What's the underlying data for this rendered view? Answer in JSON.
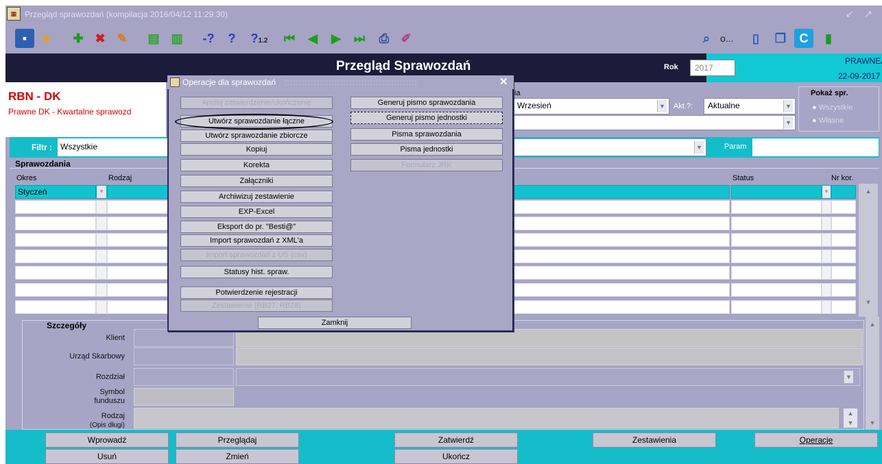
{
  "window": {
    "title": "Przegląd sprawozdań (kompilacja 2016/04/12 11:29:30)",
    "min_max": "↙ ↗"
  },
  "toolbar": {
    "icons": [
      "save-icon",
      "exit-icon",
      "add-icon",
      "delete-icon",
      "edit-icon",
      "expand-icon",
      "collapse-icon",
      "query-icon",
      "query-run-icon",
      "query-count-icon",
      "first-record-icon",
      "prev-record-icon",
      "next-record-icon",
      "last-record-icon",
      "print-icon",
      "notes-icon",
      "preview-icon",
      "options-icon",
      "document-icon",
      "windows-icon",
      "calc-icon",
      "exit-door-icon"
    ],
    "query_count_label": "1.2",
    "o_label": "o..."
  },
  "header": {
    "title": "Przegląd Sprawozdań",
    "rok_label": "Rok",
    "rok_value": "2017",
    "user": "PRAWNEAJ",
    "date": "22-09-2017"
  },
  "left": {
    "code": "RBN - DK",
    "subtitle": "Prawne DK - Kwartalne sprawozd"
  },
  "top_fields": {
    "miesiac_label": "ia",
    "miesiac_value": "Wrzesień",
    "akt_label": "Akt.?:",
    "akt_value": "Aktualne",
    "show_label": "Pokaż spr.",
    "radio_all": "Wszystkie",
    "radio_own": "Własne"
  },
  "filter": {
    "label": "Filtr :",
    "value": "Wszystkie",
    "param_label": "Param"
  },
  "grid": {
    "section": "Sprawozdania",
    "col_okres": "Okres",
    "col_rodzaj": "Rodzaj",
    "col_status": "Status",
    "col_nrkor": "Nr kor.",
    "first_row_okres": "Styczeń"
  },
  "details": {
    "section": "Szczegóły",
    "klient": "Klient",
    "urzad": "Urząd Skarbowy",
    "rozdzial": "Rozdział",
    "symbol_1": "Symbol",
    "symbol_2": "funduszu",
    "rodzaj": "Rodzaj",
    "opis": "(Opis długi)"
  },
  "bottom": {
    "wprowadz": "Wprowadź",
    "przegladaj": "Przeglądaj",
    "zatwierdz": "Zatwierdź",
    "zestawienia": "Zestawienia",
    "operacje": "Operacje",
    "usun": "Usuń",
    "zmien": "Zmień",
    "ukoncz": "Ukończ"
  },
  "dialog": {
    "title": "Operacje dla sprawozdań",
    "close": "✕",
    "left_buttons": [
      "Anuluj zatwierdzenie/ukończenie",
      "Utwórz sprawozdanie łączne",
      "Utwórz sprawozdanie zbiorcze",
      "Kopiuj",
      "Korekta",
      "Załączniki",
      "Archiwizuj zestawienie",
      "EXP-Excel",
      "Eksport do pr. \"Besti@\"",
      "Import sprawozdań z XML'a",
      "Import sprawozdań z US (csv)",
      "Statusy hist. spraw.",
      "Potwierdzenie rejestracji",
      "Zestawienia (RB27, RB28)"
    ],
    "right_buttons": [
      "Generuj pismo sprawozdania",
      "Generuj pismo jednostki",
      "Pisma sprawozdania",
      "Pisma jednostki",
      "Formularz JRK"
    ],
    "close_button": "Zamknij"
  }
}
